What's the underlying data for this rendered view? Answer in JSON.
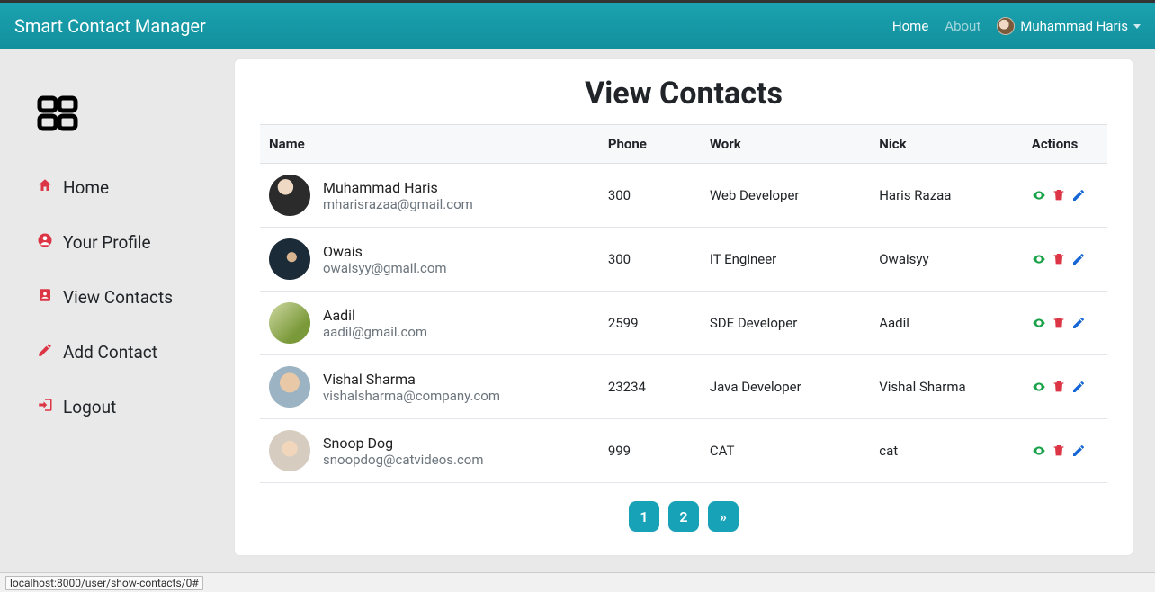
{
  "brand": "Smart Contact Manager",
  "nav": {
    "home": "Home",
    "about": "About",
    "username": "Muhammad Haris"
  },
  "sidebar": {
    "home": "Home",
    "profile": "Your Profile",
    "view": "View Contacts",
    "add": "Add Contact",
    "logout": "Logout"
  },
  "page_title": "View Contacts",
  "columns": {
    "name": "Name",
    "phone": "Phone",
    "work": "Work",
    "nick": "Nick",
    "actions": "Actions"
  },
  "rows": [
    {
      "name": "Muhammad Haris",
      "email": "mharisrazaa@gmail.com",
      "phone": "300",
      "work": "Web Developer",
      "nick": "Haris Razaa"
    },
    {
      "name": "Owais",
      "email": "owaisyy@gmail.com",
      "phone": "300",
      "work": "IT Engineer",
      "nick": "Owaisyy"
    },
    {
      "name": "Aadil",
      "email": "aadil@gmail.com",
      "phone": "2599",
      "work": "SDE Developer",
      "nick": "Aadil"
    },
    {
      "name": "Vishal Sharma",
      "email": "vishalsharma@company.com",
      "phone": "23234",
      "work": "Java Developer",
      "nick": "Vishal Sharma"
    },
    {
      "name": "Snoop Dog",
      "email": "snoopdog@catvideos.com",
      "phone": "999",
      "work": "CAT",
      "nick": "cat"
    }
  ],
  "pagination": {
    "p1": "1",
    "p2": "2",
    "next": "»"
  },
  "status_url": "localhost:8000/user/show-contacts/0#"
}
